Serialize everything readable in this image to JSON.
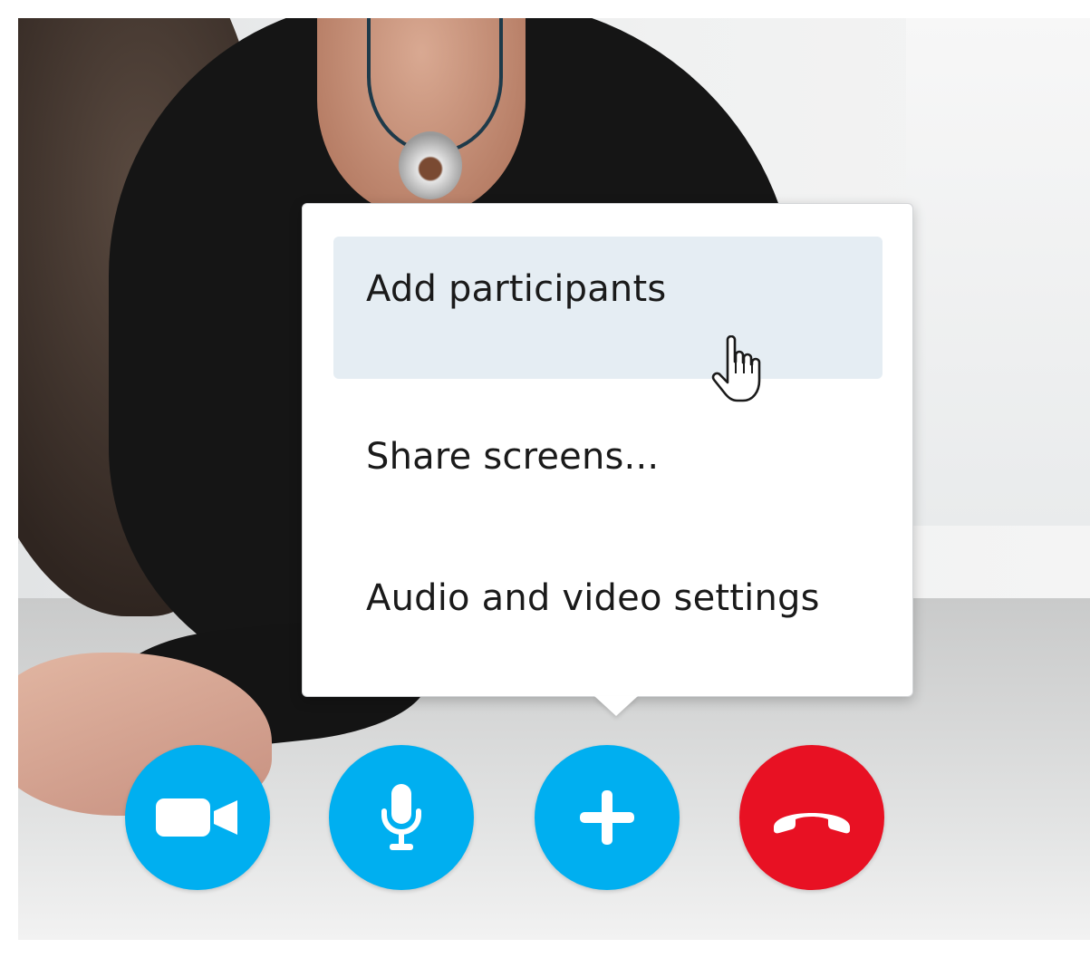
{
  "menu": {
    "items": [
      {
        "label": "Add participants",
        "state": "hover"
      },
      {
        "label": "Share screens..."
      },
      {
        "label": "Audio and video settings"
      }
    ]
  },
  "call_controls": {
    "buttons": [
      {
        "name": "video",
        "icon": "video-camera-icon",
        "color": "#00aff0"
      },
      {
        "name": "microphone",
        "icon": "microphone-icon",
        "color": "#00aff0"
      },
      {
        "name": "add",
        "icon": "plus-icon",
        "color": "#00aff0"
      },
      {
        "name": "hang-up",
        "icon": "phone-hangup-icon",
        "color": "#e81123"
      }
    ]
  },
  "cursor": {
    "icon": "hand-pointer-icon"
  },
  "colors": {
    "accent": "#00aff0",
    "danger": "#e81123",
    "menu_hover": "#e5edf3",
    "menu_background": "#ffffff"
  }
}
